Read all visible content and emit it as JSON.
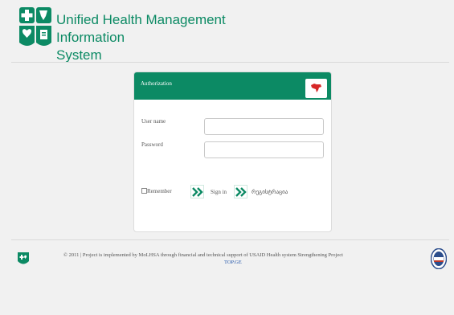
{
  "colors": {
    "brand": "#0c8a64",
    "background": "#f1f1f1",
    "flag": "#d62828",
    "link": "#2255aa"
  },
  "header": {
    "title_line1": "Unified Health Management Information",
    "title_line2": "System",
    "logo_icon": "health-cross-shield-icon"
  },
  "auth": {
    "title": "Authorization",
    "language_icon": "georgia-map-icon",
    "username_label": "User name",
    "username_value": "",
    "password_label": "Password",
    "password_value": "",
    "remember_label": "Remember",
    "remember_checked": false,
    "signin_label": "Sign in",
    "lang_link_label": "რეგისტრაცია",
    "arrow_icon": "double-chevron-right-icon"
  },
  "footer": {
    "text": "© 2011 | Project is implemented by MoLHSA through financial and technical support of USAID Health system Strengthening Project",
    "link": "TOP.GE",
    "left_logo_icon": "molhsa-emblem-icon",
    "right_logo_icon": "usaid-seal-icon"
  }
}
